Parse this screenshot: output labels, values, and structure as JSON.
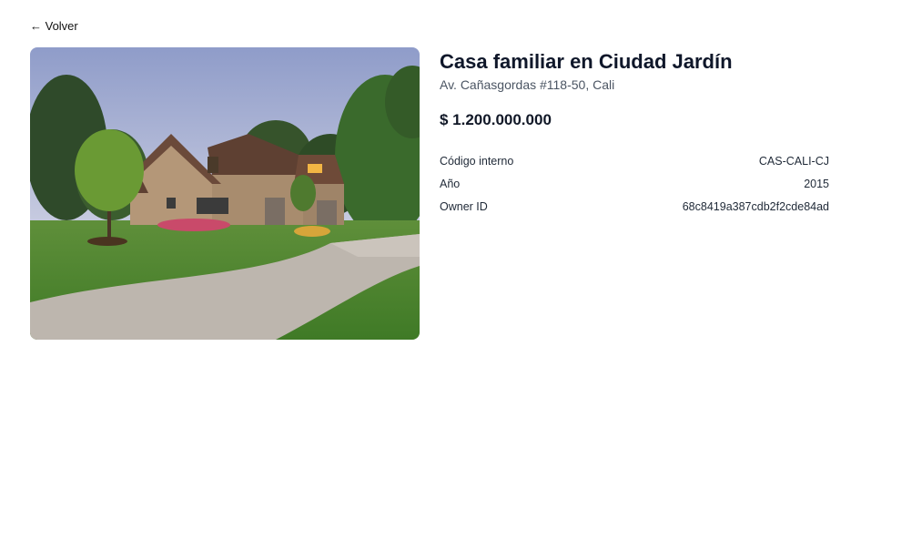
{
  "nav": {
    "back_label": "← Volver"
  },
  "property": {
    "title": "Casa familiar en Ciudad Jardín",
    "address": "Av. Cañasgordas #118-50, Cali",
    "price": "$ 1.200.000.000",
    "details": [
      {
        "label": "Código interno",
        "value": "CAS-CALI-CJ"
      },
      {
        "label": "Año",
        "value": "2015"
      },
      {
        "label": "Owner ID",
        "value": "68c8419a387cdb2f2cde84ad"
      }
    ]
  }
}
